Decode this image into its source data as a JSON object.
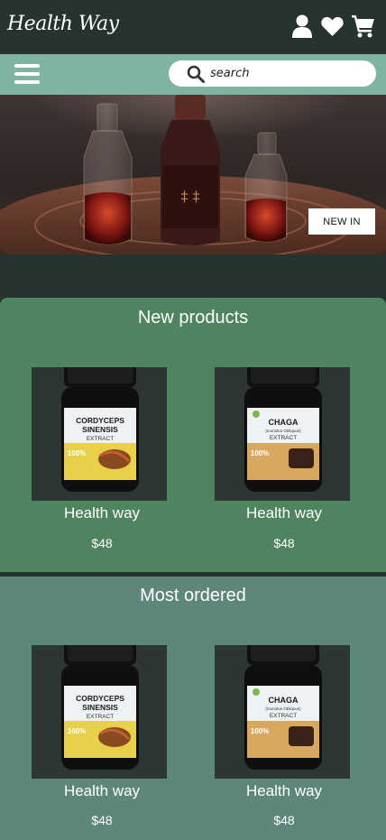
{
  "header": {
    "logo": "Health Way",
    "icons": [
      "user-icon",
      "heart-icon",
      "cart-icon"
    ]
  },
  "nav": {
    "menu_icon": "hamburger-icon",
    "search_placeholder": "search",
    "search_icon": "search-icon"
  },
  "hero": {
    "button_label": "NEW IN"
  },
  "sections": {
    "new_products": {
      "title": "New products",
      "products": [
        {
          "name": "Health way",
          "price": "$48",
          "jar_brand": "CORDYCEPS",
          "jar_sub": "SINENSIS",
          "jar_extract": "EXTRACT",
          "jar_pct": "100%"
        },
        {
          "name": "Health way",
          "price": "$48",
          "jar_brand": "CHAGA",
          "jar_sub": "(Inonotus Obliquus)",
          "jar_extract": "EXTRACT",
          "jar_pct": "100%"
        }
      ]
    },
    "most_ordered": {
      "title": "Most ordered",
      "products": [
        {
          "name": "Health way",
          "price": "$48",
          "jar_brand": "CORDYCEPS",
          "jar_sub": "SINENSIS",
          "jar_extract": "EXTRACT",
          "jar_pct": "100%"
        },
        {
          "name": "Health way",
          "price": "$48",
          "jar_brand": "CHAGA",
          "jar_sub": "(Inonotus Obliquus)",
          "jar_extract": "EXTRACT",
          "jar_pct": "100%"
        }
      ]
    }
  },
  "colors": {
    "header_bg": "#263330",
    "nav_bg": "#7fb4a3",
    "new_products_bg": "#4e8460",
    "most_ordered_bg": "#5e877c",
    "card_bg": "#2c3734"
  }
}
